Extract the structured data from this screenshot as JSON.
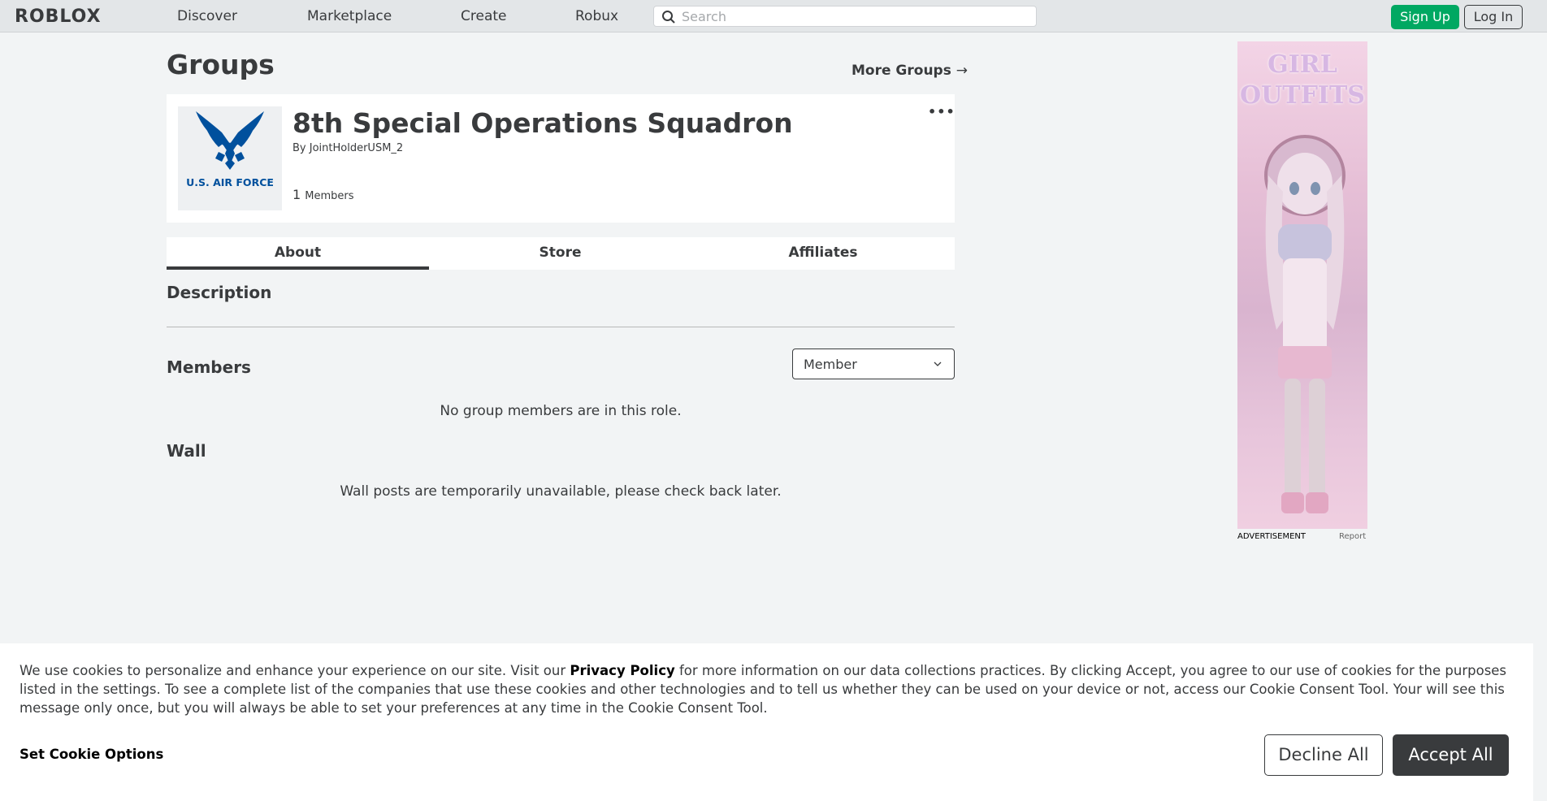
{
  "nav": {
    "logo": "ROBLOX",
    "links": [
      "Discover",
      "Marketplace",
      "Create",
      "Robux"
    ],
    "search_placeholder": "Search",
    "signup": "Sign Up",
    "login": "Log In"
  },
  "page": {
    "title": "Groups",
    "more_groups": "More Groups",
    "more_groups_arrow": "→"
  },
  "group": {
    "name": "8th Special Operations Squadron",
    "by_prefix": "By",
    "owner": "JointHolderUSM_2",
    "member_count": "1",
    "members_label": "Members",
    "more_menu": "•••",
    "logo_text": "U.S. AIR FORCE"
  },
  "tabs": [
    "About",
    "Store",
    "Affiliates"
  ],
  "sections": {
    "description": "Description",
    "members": "Members",
    "role_selected": "Member",
    "members_empty": "No group members are in this role.",
    "wall": "Wall",
    "wall_msg": "Wall posts are temporarily unavailable, please check back later."
  },
  "ad": {
    "headline_line1": "GIRL",
    "headline_line2": "OUTFITS",
    "label": "ADVERTISEMENT",
    "report": "Report"
  },
  "cookie": {
    "text_before": "We use cookies to personalize and enhance your experience on our site. Visit our ",
    "privacy_link": "Privacy Policy",
    "text_after": " for more information on our data collections practices. By clicking Accept, you agree to our use of cookies for the purposes listed in the settings. To see a complete list of the companies that use these cookies and other technologies and to tell us whether they can be used on your device or not, access our Cookie Consent Tool. Your will see this message only once, but you will always be able to set your preferences at any time in the Cookie Consent Tool.",
    "set_options": "Set Cookie Options",
    "decline": "Decline All",
    "accept": "Accept All"
  },
  "colors": {
    "accent_green": "#00a862",
    "text_dark": "#393b3d",
    "usaf_blue": "#00509d"
  }
}
